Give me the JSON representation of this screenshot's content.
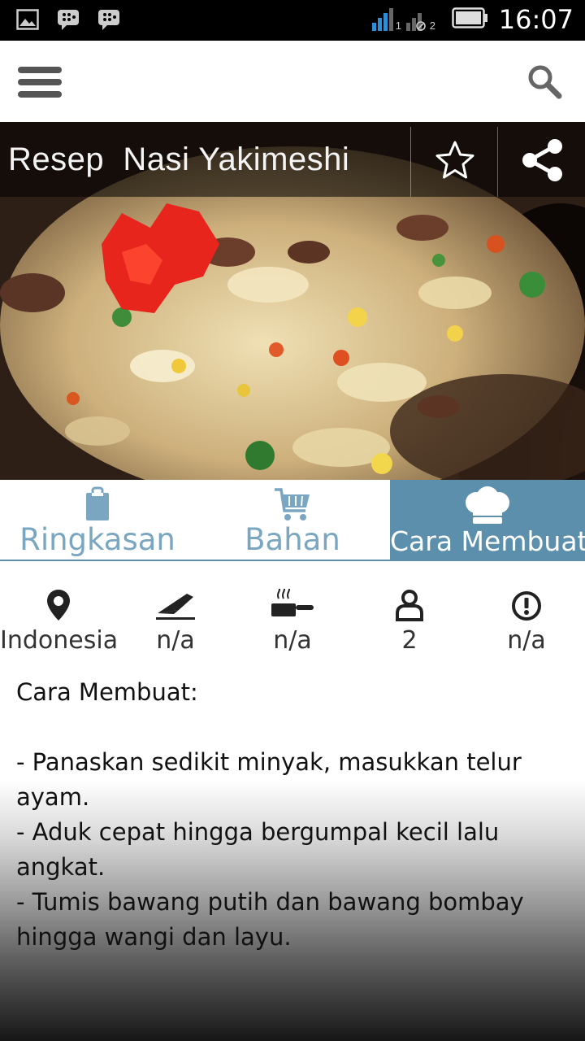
{
  "status_bar": {
    "time": "16:07",
    "sim1": "1",
    "sim2": "2",
    "icons": [
      "gallery-icon",
      "bbm-icon",
      "bbm-icon",
      "signal-icon",
      "battery-icon"
    ]
  },
  "action_bar": {
    "icons": [
      "menu-icon",
      "search-icon"
    ]
  },
  "recipe": {
    "title": "Resep  Nasi Yakimeshi",
    "icons": [
      "star-icon",
      "share-icon"
    ]
  },
  "tabs": [
    {
      "label": "Ringkasan",
      "icon": "clipboard-icon",
      "active": false
    },
    {
      "label": "Bahan",
      "icon": "cart-icon",
      "active": false
    },
    {
      "label": "Cara Membuat",
      "icon": "chef-hat-icon",
      "active": true
    }
  ],
  "info": [
    {
      "label": "Indonesia",
      "icon": "location-pin-icon"
    },
    {
      "label": "n/a",
      "icon": "knife-icon"
    },
    {
      "label": "n/a",
      "icon": "pan-icon"
    },
    {
      "label": "2",
      "icon": "person-icon"
    },
    {
      "label": "n/a",
      "icon": "alert-icon"
    }
  ],
  "content": {
    "heading": "Cara Membuat:",
    "steps": [
      "- Panaskan sedikit minyak, masukkan telur ayam.",
      "- Aduk cepat hingga bergumpal kecil lalu angkat.",
      "- Tumis bawang putih dan bawang bombay hingga wangi dan layu."
    ]
  },
  "colors": {
    "accent": "#5b8fab",
    "tab_text": "#7aa6c1",
    "status_bar": "#000000"
  }
}
